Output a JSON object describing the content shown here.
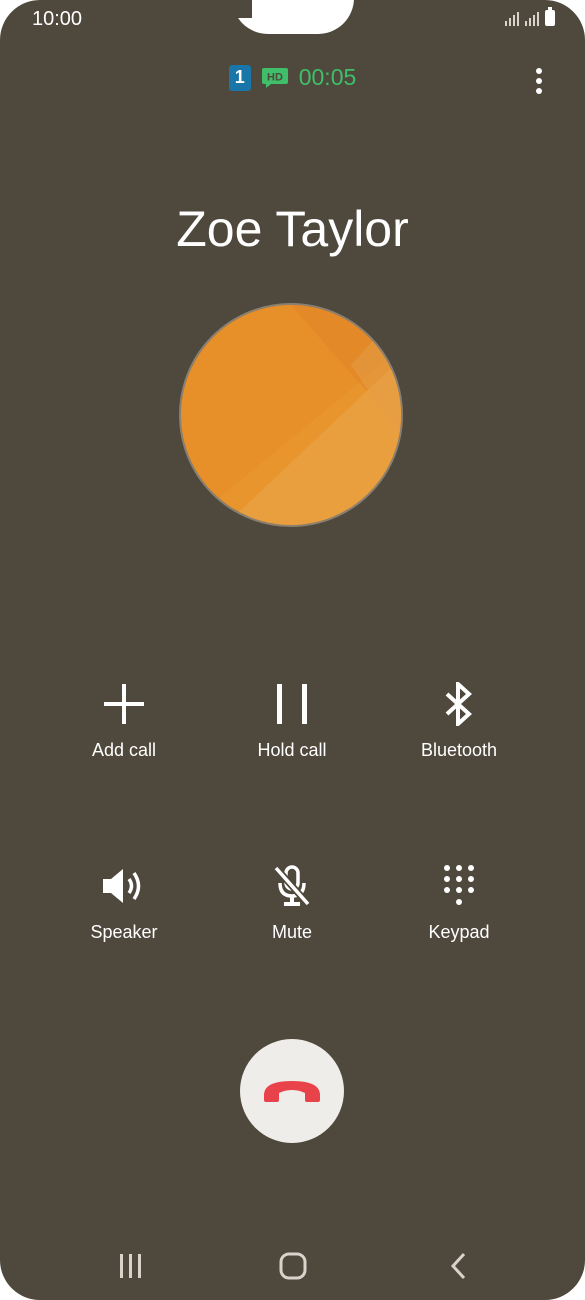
{
  "status_bar": {
    "time": "10:00",
    "icons": [
      "signal-icon",
      "signal-icon",
      "battery-icon"
    ]
  },
  "call": {
    "sim_slot": "1",
    "hd_icon": "hd-voice-icon",
    "duration": "00:05",
    "caller_name": "Zoe Taylor",
    "avatar_color": "#e8952e"
  },
  "actions": [
    {
      "label": "Add call",
      "icon": "plus-icon"
    },
    {
      "label": "Hold call",
      "icon": "pause-icon"
    },
    {
      "label": "Bluetooth",
      "icon": "bluetooth-icon"
    },
    {
      "label": "Speaker",
      "icon": "speaker-icon"
    },
    {
      "label": "Mute",
      "icon": "mic-off-icon"
    },
    {
      "label": "Keypad",
      "icon": "keypad-icon"
    }
  ],
  "end_call": {
    "icon": "end-call-icon",
    "color": "#e8434a"
  },
  "nav_bar": {
    "icons": [
      "recents-icon",
      "home-icon",
      "back-icon"
    ]
  },
  "colors": {
    "background": "#4f483c",
    "accent_green": "#3fbf6a",
    "sim_blue": "#1a76a8"
  }
}
